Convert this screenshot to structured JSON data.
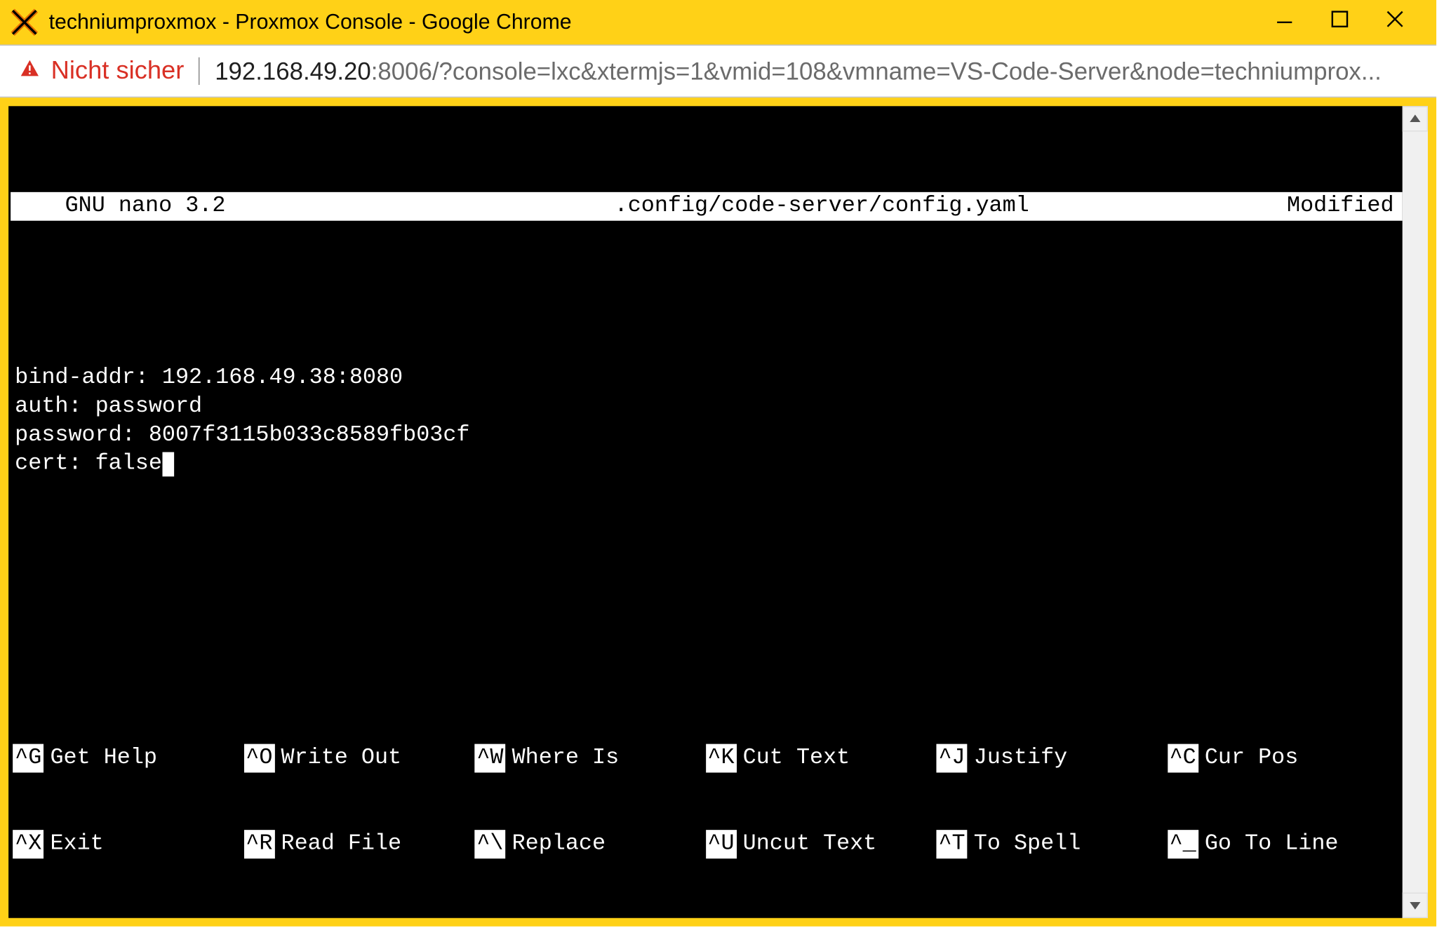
{
  "window": {
    "title": "techniumproxmox - Proxmox Console - Google Chrome"
  },
  "omnibox": {
    "insecure_label": "Nicht sicher",
    "url_plain": "192.168.49.20",
    "url_muted_port": ":8006",
    "url_rest": "/?console=lxc&xtermjs=1&vmid=108&vmname=VS-Code-Server&node=techniumprox..."
  },
  "nano": {
    "app": "  GNU nano 3.2",
    "file": ".config/code-server/config.yaml",
    "status": "Modified",
    "shortcuts_row1": [
      {
        "key": "^G",
        "label": "Get Help"
      },
      {
        "key": "^O",
        "label": "Write Out"
      },
      {
        "key": "^W",
        "label": "Where Is"
      },
      {
        "key": "^K",
        "label": "Cut Text"
      },
      {
        "key": "^J",
        "label": "Justify"
      },
      {
        "key": "^C",
        "label": "Cur Pos"
      }
    ],
    "shortcuts_row2": [
      {
        "key": "^X",
        "label": "Exit"
      },
      {
        "key": "^R",
        "label": "Read File"
      },
      {
        "key": "^\\",
        "label": "Replace"
      },
      {
        "key": "^U",
        "label": "Uncut Text"
      },
      {
        "key": "^T",
        "label": "To Spell"
      },
      {
        "key": "^_",
        "label": "Go To Line"
      }
    ]
  },
  "editor": {
    "lines": [
      "",
      "bind-addr: 192.168.49.38:8080",
      "auth: password",
      "password: 8007f3115b033c8589fb03cf",
      "cert: false"
    ],
    "cursor_line": 4
  }
}
